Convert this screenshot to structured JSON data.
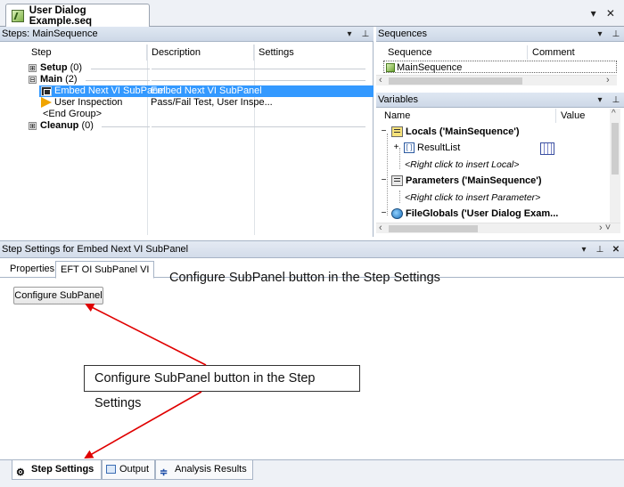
{
  "document": {
    "tab_title": "User Dialog Example.seq",
    "controls": "▾ ✕"
  },
  "steps_panel": {
    "title": "Steps: MainSequence",
    "columns": [
      "Step",
      "Description",
      "Settings"
    ],
    "rows": [
      {
        "name": "Setup",
        "count": "(0)",
        "expander": "⊞"
      },
      {
        "name": "Main",
        "count": "(2)",
        "expander": "⊟"
      },
      {
        "name": "Embed Next VI SubPanel",
        "description": "Embed Next VI SubPanel",
        "selected": true
      },
      {
        "name": "User Inspection",
        "description": "Pass/Fail Test,  User Inspe..."
      },
      {
        "name": "<End Group>"
      },
      {
        "name": "Cleanup",
        "count": "(0)",
        "expander": "⊞"
      }
    ]
  },
  "sequences_panel": {
    "title": "Sequences",
    "columns": [
      "Sequence",
      "Comment"
    ],
    "items": [
      "MainSequence"
    ]
  },
  "variables_panel": {
    "title": "Variables",
    "columns": [
      "Name",
      "Value"
    ],
    "locals": "Locals ('MainSequence')",
    "result_list": "ResultList",
    "insert_local": "<Right click to insert Local>",
    "parameters": "Parameters ('MainSequence')",
    "insert_parameter": "<Right click to insert Parameter>",
    "file_globals": "FileGlobals ('User Dialog Exam..."
  },
  "settings_panel": {
    "title": "Step Settings for Embed Next VI SubPanel",
    "tabs": [
      "Properties",
      "EFT OI SubPanel VI"
    ],
    "configure_button": "Configure SubPanel"
  },
  "annotations": {
    "top_note": "Configure SubPanel button in the Step Settings",
    "callout": "Configure SubPanel button in the Step Settings"
  },
  "bottom_tabs": [
    "Step Settings",
    "Output",
    "Analysis Results"
  ],
  "colors": {
    "selection": "#3399ff",
    "arrow": "#e00000"
  }
}
